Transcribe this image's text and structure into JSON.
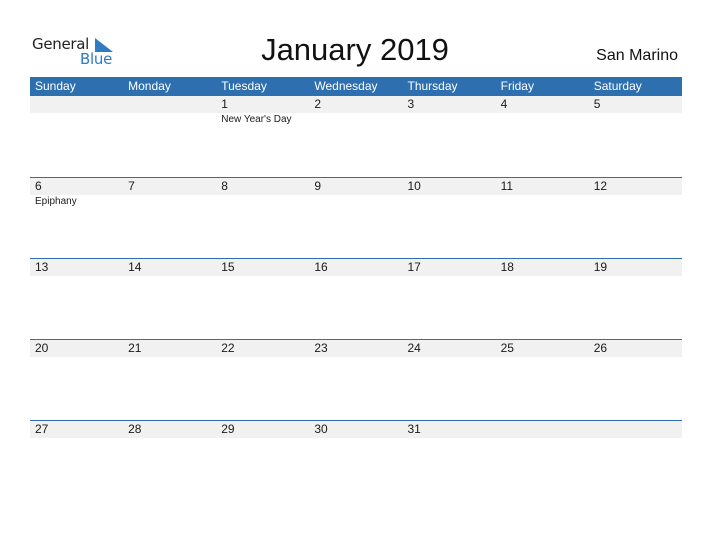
{
  "logo": {
    "word1": "General",
    "word2": "Blue",
    "accent": "#2f7cc3"
  },
  "header": {
    "title": "January 2019",
    "country": "San Marino"
  },
  "colors": {
    "header_bg": "#2e6fb0",
    "day_row_bg": "#f1f1f1"
  },
  "weekdays": [
    "Sunday",
    "Monday",
    "Tuesday",
    "Wednesday",
    "Thursday",
    "Friday",
    "Saturday"
  ],
  "weeks": [
    {
      "days": [
        "",
        "",
        "1",
        "2",
        "3",
        "4",
        "5"
      ],
      "events": [
        "",
        "",
        "New Year's Day",
        "",
        "",
        "",
        ""
      ]
    },
    {
      "days": [
        "6",
        "7",
        "8",
        "9",
        "10",
        "11",
        "12"
      ],
      "events": [
        "Epiphany",
        "",
        "",
        "",
        "",
        "",
        ""
      ]
    },
    {
      "days": [
        "13",
        "14",
        "15",
        "16",
        "17",
        "18",
        "19"
      ],
      "events": [
        "",
        "",
        "",
        "",
        "",
        "",
        ""
      ]
    },
    {
      "days": [
        "20",
        "21",
        "22",
        "23",
        "24",
        "25",
        "26"
      ],
      "events": [
        "",
        "",
        "",
        "",
        "",
        "",
        ""
      ]
    },
    {
      "days": [
        "27",
        "28",
        "29",
        "30",
        "31",
        "",
        ""
      ],
      "events": [
        "",
        "",
        "",
        "",
        "",
        "",
        ""
      ]
    }
  ]
}
